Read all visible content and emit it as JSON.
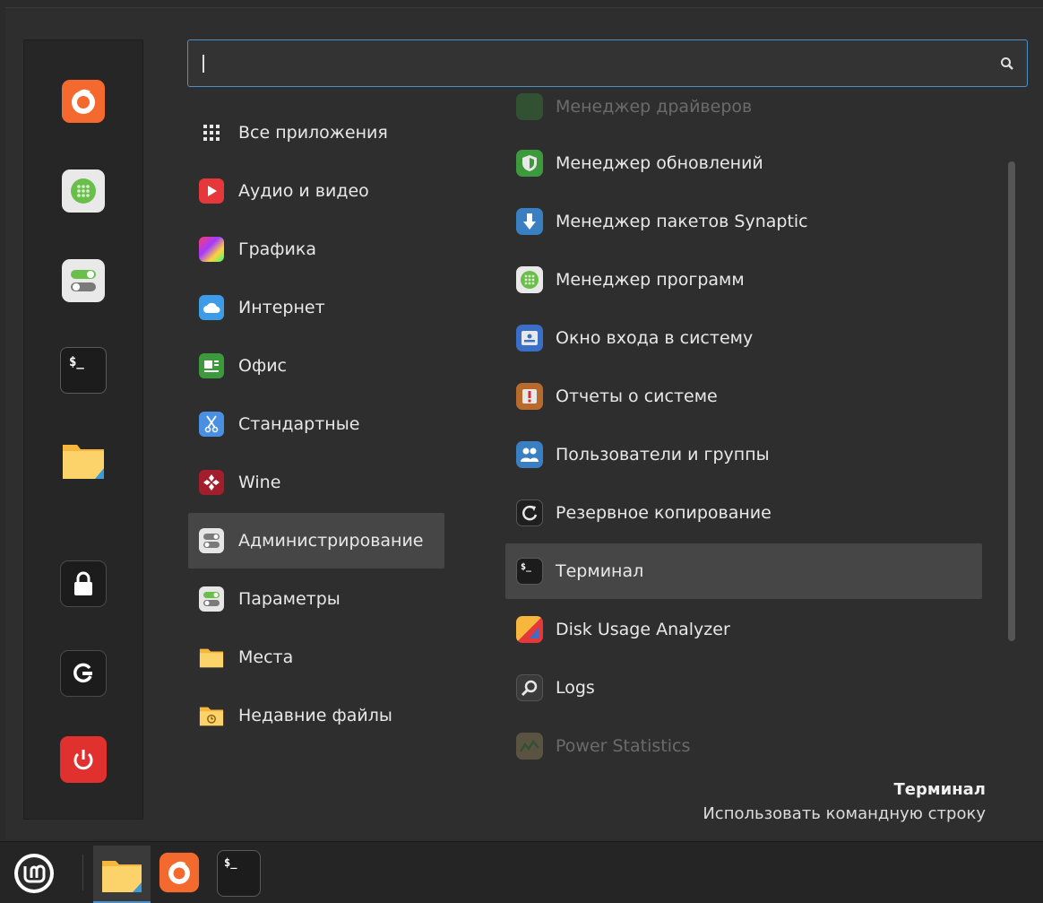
{
  "search": {
    "value": "",
    "placeholder": ""
  },
  "favorites": [
    {
      "name": "firefox-icon"
    },
    {
      "name": "software-manager-icon"
    },
    {
      "name": "settings-icon"
    },
    {
      "name": "terminal-icon",
      "glyph": "$_"
    },
    {
      "name": "folder-icon"
    },
    {
      "name": "lock-icon"
    },
    {
      "name": "logout-icon"
    },
    {
      "name": "power-icon"
    }
  ],
  "categories": [
    {
      "label": "Все приложения",
      "icon": "grid-icon"
    },
    {
      "label": "Аудио и видео",
      "icon": "play-icon"
    },
    {
      "label": "Графика",
      "icon": "graphics-icon"
    },
    {
      "label": "Интернет",
      "icon": "cloud-icon"
    },
    {
      "label": "Офис",
      "icon": "office-icon"
    },
    {
      "label": "Стандартные",
      "icon": "scissors-icon"
    },
    {
      "label": "Wine",
      "icon": "wine-icon"
    },
    {
      "label": "Администрирование",
      "icon": "admin-icon"
    },
    {
      "label": "Параметры",
      "icon": "preferences-icon"
    },
    {
      "label": "Места",
      "icon": "folder-icon"
    },
    {
      "label": "Недавние файлы",
      "icon": "recent-files-icon"
    }
  ],
  "selected_category": "Администрирование",
  "apps": [
    {
      "label": "Менеджер драйверов",
      "icon": "driver-manager-icon"
    },
    {
      "label": "Менеджер обновлений",
      "icon": "update-manager-icon"
    },
    {
      "label": "Менеджер пакетов Synaptic",
      "icon": "synaptic-icon"
    },
    {
      "label": "Менеджер программ",
      "icon": "software-manager-icon"
    },
    {
      "label": "Окно входа в систему",
      "icon": "login-window-icon"
    },
    {
      "label": "Отчеты о системе",
      "icon": "system-reports-icon"
    },
    {
      "label": "Пользователи и группы",
      "icon": "users-groups-icon"
    },
    {
      "label": "Резервное копирование",
      "icon": "backup-icon"
    },
    {
      "label": "Терминал",
      "icon": "terminal-icon"
    },
    {
      "label": "Disk Usage Analyzer",
      "icon": "disk-usage-icon"
    },
    {
      "label": "Logs",
      "icon": "logs-icon"
    },
    {
      "label": "Power Statistics",
      "icon": "power-statistics-icon"
    }
  ],
  "selected_app": "Терминал",
  "description": {
    "title": "Терминал",
    "text": "Использовать командную строку"
  },
  "taskbar": {
    "menu_button": "mint-logo-icon",
    "items": [
      "folder-icon",
      "firefox-icon",
      "terminal-icon"
    ],
    "terminal_glyph": "$_"
  },
  "colors": {
    "accent": "#4d8fc9",
    "selection": "#464646",
    "background": "#2e2e2e"
  }
}
